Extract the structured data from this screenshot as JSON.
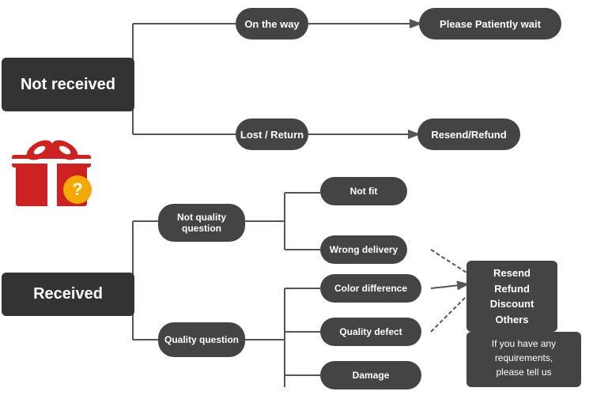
{
  "nodes": {
    "not_received": "Not received",
    "on_the_way": "On the way",
    "please_wait": "Please Patiently wait",
    "lost_return": "Lost / Return",
    "resend_refund_top": "Resend/Refund",
    "received": "Received",
    "not_quality": "Not quality\nquestion",
    "quality_question": "Quality question",
    "not_fit": "Not fit",
    "wrong_delivery": "Wrong delivery",
    "color_difference": "Color difference",
    "quality_defect": "Quality defect",
    "damage": "Damage",
    "resend_options": "Resend\nRefund\nDiscount\nOthers",
    "if_requirements": "If you have any\nrequirements,\nplease tell us"
  }
}
